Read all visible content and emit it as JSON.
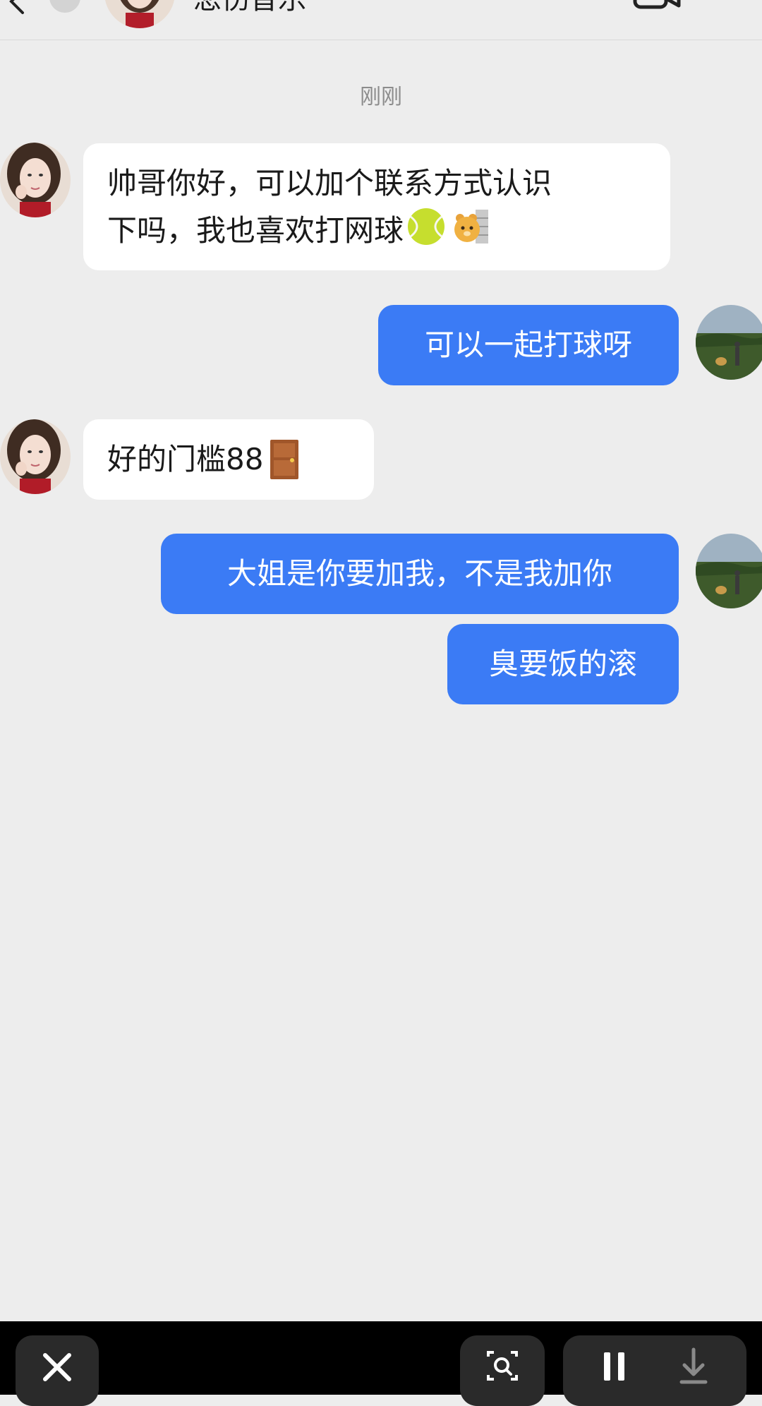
{
  "header": {
    "contact_name": "悲伤音乐"
  },
  "chat": {
    "timestamp": "刚刚",
    "messages": [
      {
        "side": "in",
        "line1": "帅哥你好，可以加个联系方式认识",
        "line2": "下吗，我也喜欢打网球",
        "emojis": [
          "tennis-ball-emoji",
          "peeking-bear-emoji"
        ]
      },
      {
        "side": "out",
        "text": "可以一起打球呀"
      },
      {
        "side": "in",
        "text": "好的门槛88",
        "emojis": [
          "door-emoji"
        ]
      },
      {
        "side": "out",
        "text": "大姐是你要加我，不是我加你"
      },
      {
        "side": "out",
        "text": "臭要饭的滚"
      }
    ]
  },
  "bottom_bar": {
    "icons": [
      "close-icon",
      "scan-icon",
      "pause-icon",
      "download-icon"
    ]
  },
  "colors": {
    "background": "#EDEDED",
    "incoming_bubble": "#FFFFFF",
    "outgoing_bubble": "#3B7BF5",
    "bottom_bar": "#000000"
  }
}
